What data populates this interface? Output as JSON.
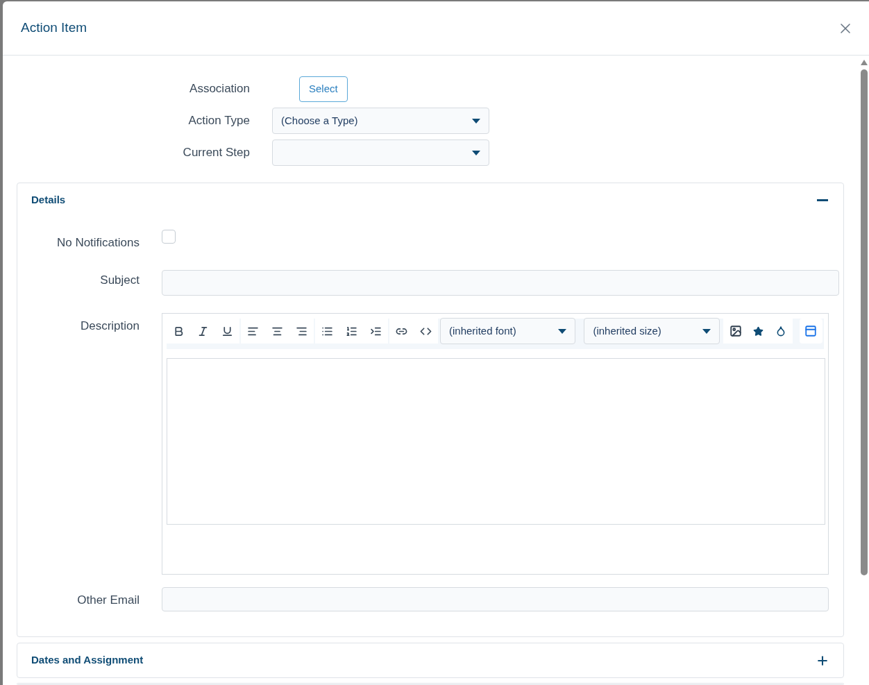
{
  "dialog": {
    "title": "Action Item"
  },
  "top_fields": [
    {
      "label": "Association",
      "kind": "button",
      "value": "Select"
    },
    {
      "label": "Action Type",
      "kind": "dropdown",
      "value": "(Choose a Type)"
    },
    {
      "label": "Current Step",
      "kind": "dropdown"
    }
  ],
  "sections": [
    {
      "title": "Details",
      "expanded": true
    },
    {
      "title": "Dates and Assignment",
      "expanded": false
    }
  ],
  "details": {
    "no_notifications": {
      "label": "No Notifications",
      "checked": false
    },
    "subject": {
      "label": "Subject"
    },
    "description": {
      "label": "Description",
      "font": "(inherited font)",
      "size": "(inherited size)"
    },
    "other_email": {
      "label": "Other Email"
    }
  }
}
